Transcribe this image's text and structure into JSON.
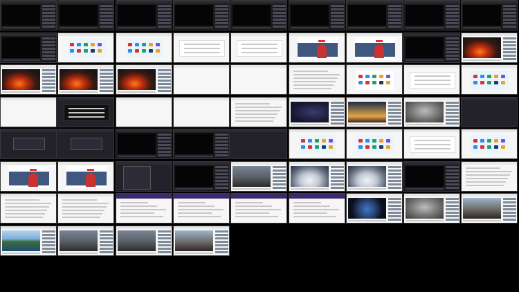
{
  "screen": {
    "title": "",
    "grid": {
      "rows": [
        {
          "tiles": [
            {
              "kind": "video-dark",
              "thumb": "black"
            },
            {
              "kind": "video-dark",
              "thumb": "black"
            },
            {
              "kind": "video-dark",
              "thumb": "black"
            },
            {
              "kind": "video-dark",
              "thumb": "black"
            },
            {
              "kind": "video-dark",
              "thumb": "black"
            },
            {
              "kind": "video-dark",
              "thumb": "black"
            },
            {
              "kind": "video-dark",
              "thumb": "black"
            },
            {
              "kind": "video-dark",
              "thumb": "black"
            },
            {
              "kind": "video-dark",
              "thumb": "black"
            }
          ]
        },
        {
          "tiles": [
            {
              "kind": "video-dark",
              "thumb": "black"
            },
            {
              "kind": "start-page"
            },
            {
              "kind": "start-page"
            },
            {
              "kind": "login-form"
            },
            {
              "kind": "blank-form"
            },
            {
              "kind": "promo-red"
            },
            {
              "kind": "promo-red"
            },
            {
              "kind": "video-dark",
              "thumb": "black"
            },
            {
              "kind": "video",
              "thumb": "volcano-red"
            }
          ]
        },
        {
          "tiles": [
            {
              "kind": "video",
              "thumb": "volcano-red"
            },
            {
              "kind": "video",
              "thumb": "volcano-red"
            },
            {
              "kind": "video",
              "thumb": "volcano-red"
            },
            {
              "kind": "blank"
            },
            {
              "kind": "blank"
            },
            {
              "kind": "article"
            },
            {
              "kind": "start-page-red"
            },
            {
              "kind": "blank-form"
            },
            {
              "kind": "start-page"
            }
          ]
        },
        {
          "tiles": [
            {
              "kind": "blank"
            },
            {
              "kind": "login-form-dark"
            },
            {
              "kind": "blank"
            },
            {
              "kind": "blank"
            },
            {
              "kind": "article"
            },
            {
              "kind": "video",
              "thumb": "night"
            },
            {
              "kind": "video",
              "thumb": "sunset"
            },
            {
              "kind": "video",
              "thumb": "fog"
            },
            {
              "kind": "dark-blank"
            }
          ]
        },
        {
          "tiles": [
            {
              "kind": "dark-dialog"
            },
            {
              "kind": "dark-dialog"
            },
            {
              "kind": "video-dark",
              "thumb": "black"
            },
            {
              "kind": "video-dark",
              "thumb": "black"
            },
            {
              "kind": "dark-blank"
            },
            {
              "kind": "start-page"
            },
            {
              "kind": "start-page"
            },
            {
              "kind": "blank-form"
            },
            {
              "kind": "start-page"
            }
          ]
        },
        {
          "tiles": [
            {
              "kind": "promo-red"
            },
            {
              "kind": "promo-red"
            },
            {
              "kind": "dark-menu"
            },
            {
              "kind": "video-dark",
              "thumb": "black"
            },
            {
              "kind": "video",
              "thumb": "volcano-grey"
            },
            {
              "kind": "video",
              "thumb": "snow"
            },
            {
              "kind": "video",
              "thumb": "snow"
            },
            {
              "kind": "video-dark",
              "thumb": "black"
            },
            {
              "kind": "article"
            }
          ]
        },
        {
          "tiles": [
            {
              "kind": "article"
            },
            {
              "kind": "article"
            },
            {
              "kind": "purple-header"
            },
            {
              "kind": "purple-header"
            },
            {
              "kind": "purple-header"
            },
            {
              "kind": "purple-header"
            },
            {
              "kind": "video",
              "thumb": "earth"
            },
            {
              "kind": "video",
              "thumb": "fog"
            },
            {
              "kind": "video",
              "thumb": "smoke"
            }
          ]
        },
        {
          "tiles": [
            {
              "kind": "video",
              "thumb": "island"
            },
            {
              "kind": "video",
              "thumb": "volcano-grey"
            },
            {
              "kind": "video",
              "thumb": "volcano-grey"
            },
            {
              "kind": "video",
              "thumb": "smoke"
            }
          ]
        }
      ]
    },
    "colors": {
      "background": "#000000",
      "accent": "#e03030",
      "tile_border": "#3a3a3a"
    }
  }
}
